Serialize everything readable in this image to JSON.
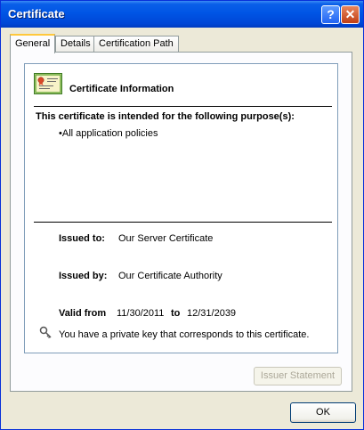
{
  "window": {
    "title": "Certificate",
    "help_glyph": "?",
    "close_glyph": "✕"
  },
  "tabs": [
    {
      "label": "General",
      "active": true
    },
    {
      "label": "Details",
      "active": false
    },
    {
      "label": "Certification Path",
      "active": false
    }
  ],
  "general": {
    "info_title": "Certificate Information",
    "purpose_heading": "This certificate is intended for the following purpose(s):",
    "purpose_bullet": "•",
    "purposes": [
      "All application policies"
    ],
    "issued_to_label": "Issued to:",
    "issued_to_value": "Our Server Certificate",
    "issued_by_label": "Issued by:",
    "issued_by_value": "Our Certificate Authority",
    "valid_from_label": "Valid from",
    "valid_from_value": "11/30/2011",
    "valid_to_label": "to",
    "valid_to_value": "12/31/2039",
    "private_key_note": "You have a private key that corresponds to this certificate."
  },
  "buttons": {
    "issuer_statement": "Issuer Statement",
    "ok": "OK"
  },
  "colors": {
    "titlebar": "#0055E5",
    "dialog_bg": "#ECE9D8",
    "tab_highlight": "#FFC83C",
    "border": "#919B9C"
  },
  "icons": {
    "certificate": "certificate-icon",
    "key": "key-icon"
  }
}
